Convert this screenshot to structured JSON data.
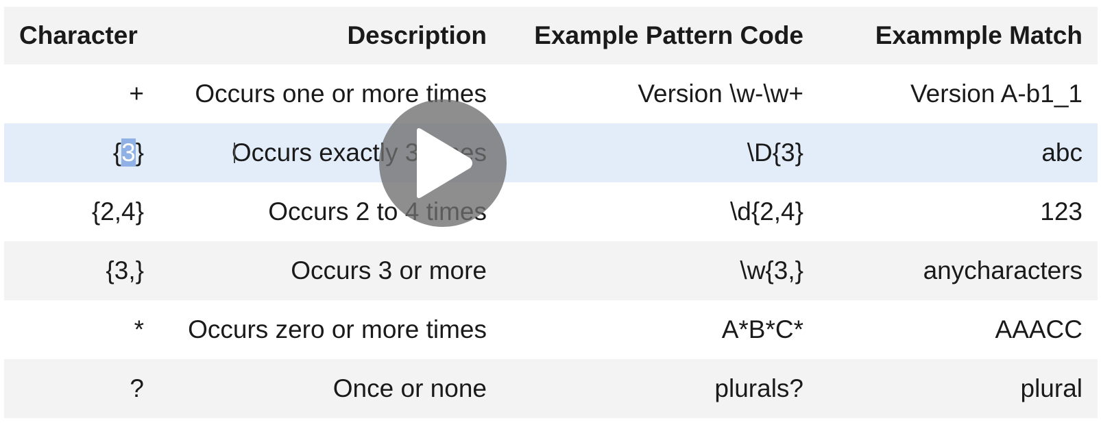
{
  "table": {
    "headers": [
      "Character",
      "Description",
      "Example Pattern Code",
      "Exammple Match"
    ],
    "rows": [
      {
        "character": "+",
        "description": "Occurs one or more times",
        "pattern": "Version \\w-\\w+",
        "match": "Version A-b1_1"
      },
      {
        "character_prefix": "{",
        "character_selected": "3",
        "character_suffix": "}",
        "description": "Occurs exactly 3 times",
        "pattern": "\\D{3}",
        "match": "abc",
        "selected": true
      },
      {
        "character": "{2,4}",
        "description": "Occurs 2 to 4 times",
        "pattern": "\\d{2,4}",
        "match": "123"
      },
      {
        "character": "{3,}",
        "description": "Occurs 3 or more",
        "pattern": "\\w{3,}",
        "match": "anycharacters"
      },
      {
        "character": "*",
        "description": "Occurs zero or more times",
        "pattern": "A*B*C*",
        "match": "AAACC"
      },
      {
        "character": "?",
        "description": "Once or none",
        "pattern": "plurals?",
        "match": "plural"
      }
    ]
  },
  "overlay": {
    "icon": "play-icon",
    "color": "#6e6e6e"
  },
  "colors": {
    "header_bg": "#f3f3f3",
    "striped_row_bg": "#f3f3f3",
    "selected_row_bg": "#e3edf9",
    "text_selection": "#8fb1e6"
  }
}
